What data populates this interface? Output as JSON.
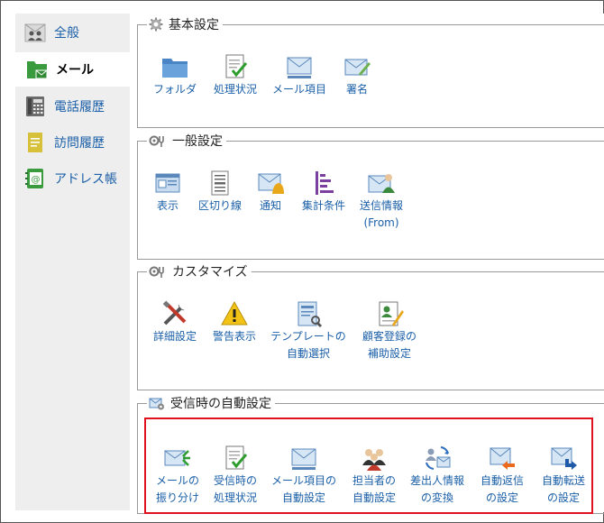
{
  "sidebar": {
    "items": [
      {
        "label": "全般",
        "icon": "users-icon"
      },
      {
        "label": "メール",
        "icon": "mail-folder-icon"
      },
      {
        "label": "電話履歴",
        "icon": "phone-icon"
      },
      {
        "label": "訪問履歴",
        "icon": "document-icon"
      },
      {
        "label": "アドレス帳",
        "icon": "address-book-icon"
      }
    ],
    "active_index": 1
  },
  "sections": [
    {
      "title": "基本設定",
      "items": [
        {
          "label1": "フォルダ",
          "label2": "",
          "icon": "folder-icon"
        },
        {
          "label1": "処理状況",
          "label2": "",
          "icon": "status-check-icon"
        },
        {
          "label1": "メール項目",
          "label2": "",
          "icon": "mail-item-icon"
        },
        {
          "label1": "署名",
          "label2": "",
          "icon": "signature-icon"
        }
      ]
    },
    {
      "title": "一般設定",
      "items": [
        {
          "label1": "表示",
          "label2": "",
          "icon": "display-icon"
        },
        {
          "label1": "区切り線",
          "label2": "",
          "icon": "separator-icon"
        },
        {
          "label1": "通知",
          "label2": "",
          "icon": "notification-icon"
        },
        {
          "label1": "集計条件",
          "label2": "",
          "icon": "aggregate-icon"
        },
        {
          "label1": "送信情報",
          "label2": "(From)",
          "icon": "sender-info-icon"
        }
      ]
    },
    {
      "title": "カスタマイズ",
      "items": [
        {
          "label1": "詳細設定",
          "label2": "",
          "icon": "tools-icon"
        },
        {
          "label1": "警告表示",
          "label2": "",
          "icon": "warning-icon"
        },
        {
          "label1": "テンプレートの",
          "label2": "自動選択",
          "icon": "template-icon"
        },
        {
          "label1": "顧客登録の",
          "label2": "補助設定",
          "icon": "customer-register-icon"
        }
      ]
    },
    {
      "title": "受信時の自動設定",
      "items": [
        {
          "label1": "メールの",
          "label2": "振り分け",
          "icon": "mail-sort-icon"
        },
        {
          "label1": "受信時の",
          "label2": "処理状況",
          "icon": "receive-status-icon"
        },
        {
          "label1": "メール項目の",
          "label2": "自動設定",
          "icon": "mail-item-auto-icon"
        },
        {
          "label1": "担当者の",
          "label2": "自動設定",
          "icon": "assignee-icon"
        },
        {
          "label1": "差出人情報",
          "label2": "の変換",
          "icon": "sender-convert-icon"
        },
        {
          "label1": "自動返信",
          "label2": "の設定",
          "icon": "auto-reply-icon"
        },
        {
          "label1": "自動転送",
          "label2": "の設定",
          "icon": "auto-forward-icon"
        }
      ]
    }
  ],
  "colors": {
    "link": "#1a5fa8",
    "highlight": "#e0101c",
    "sidebar_bg": "#eeeeee"
  }
}
